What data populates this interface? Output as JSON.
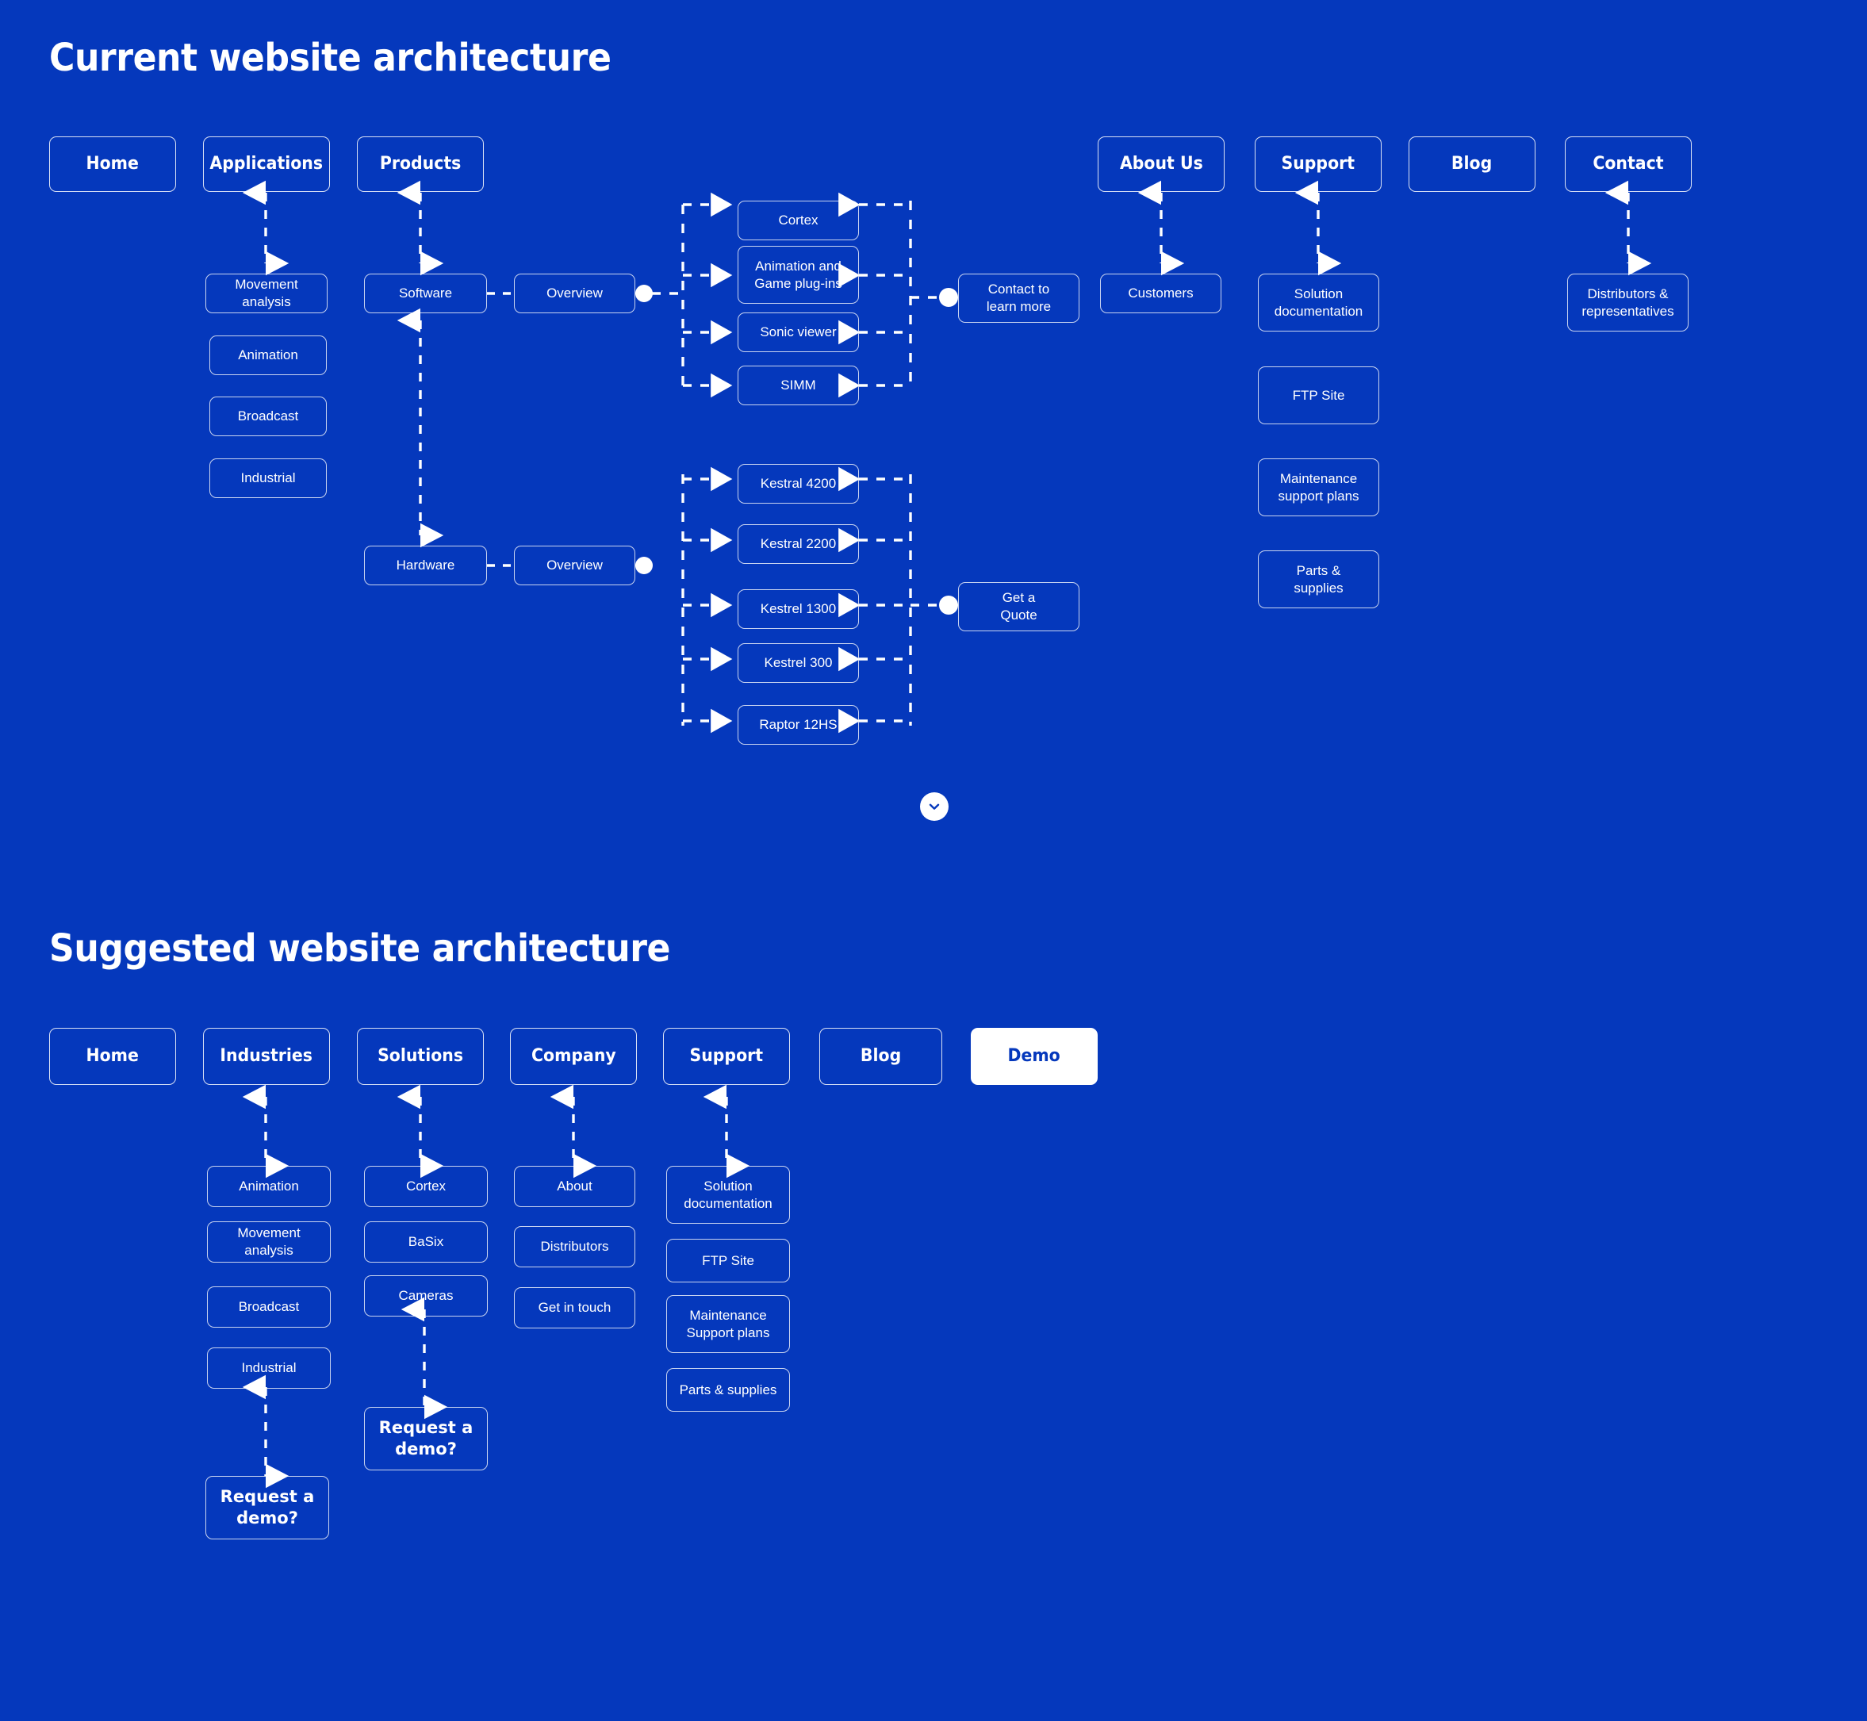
{
  "theme": {
    "background": "#0538bc",
    "line": "#ffffff",
    "text": "#ffffff",
    "cta_background": "#ffffff",
    "cta_text": "#0538bc"
  },
  "sections": [
    {
      "id": "current",
      "title": "Current website architecture",
      "nav": [
        {
          "label": "Home"
        },
        {
          "label": "Applications"
        },
        {
          "label": "Products"
        },
        {
          "label": "About Us"
        },
        {
          "label": "Support"
        },
        {
          "label": "Blog"
        },
        {
          "label": "Contact"
        }
      ],
      "applications_children": [
        {
          "label": "Movement analysis"
        },
        {
          "label": "Animation"
        },
        {
          "label": "Broadcast"
        },
        {
          "label": "Industrial"
        }
      ],
      "products_branches": [
        {
          "label": "Software",
          "overview_label": "Overview",
          "items": [
            {
              "label": "Cortex"
            },
            {
              "label": "Animation and\nGame plug-ins"
            },
            {
              "label": "Sonic viewer"
            },
            {
              "label": "SIMM"
            }
          ],
          "endpoint": "Contact to\nlearn more"
        },
        {
          "label": "Hardware",
          "overview_label": "Overview",
          "items": [
            {
              "label": "Kestral 4200"
            },
            {
              "label": "Kestral 2200"
            },
            {
              "label": "Kestrel 1300"
            },
            {
              "label": "Kestrel 300"
            },
            {
              "label": "Raptor 12HS"
            }
          ],
          "endpoint": "Get a\nQuote"
        }
      ],
      "about_children": [
        {
          "label": "Customers"
        }
      ],
      "support_children": [
        {
          "label": "Solution\ndocumentation"
        },
        {
          "label": "FTP Site"
        },
        {
          "label": "Maintenance\nsupport plans"
        },
        {
          "label": "Parts &\nsupplies"
        }
      ],
      "contact_children": [
        {
          "label": "Distributors &\nrepresentatives"
        }
      ]
    },
    {
      "id": "suggested",
      "title": "Suggested website architecture",
      "nav": [
        {
          "label": "Home",
          "cta": false
        },
        {
          "label": "Industries",
          "cta": false
        },
        {
          "label": "Solutions",
          "cta": false
        },
        {
          "label": "Company",
          "cta": false
        },
        {
          "label": "Support",
          "cta": false
        },
        {
          "label": "Blog",
          "cta": false
        },
        {
          "label": "Demo",
          "cta": true
        }
      ],
      "industries_children": [
        {
          "label": "Animation"
        },
        {
          "label": "Movement analysis"
        },
        {
          "label": "Broadcast"
        },
        {
          "label": "Industrial"
        }
      ],
      "industries_cta": "Request a\ndemo?",
      "solutions_children": [
        {
          "label": "Cortex"
        },
        {
          "label": "BaSix"
        },
        {
          "label": "Cameras"
        }
      ],
      "solutions_cta": "Request a\ndemo?",
      "company_children": [
        {
          "label": "About"
        },
        {
          "label": "Distributors"
        },
        {
          "label": "Get in touch"
        }
      ],
      "support_children": [
        {
          "label": "Solution\ndocumentation"
        },
        {
          "label": "FTP Site"
        },
        {
          "label": "Maintenance\nSupport plans"
        },
        {
          "label": "Parts & supplies"
        }
      ]
    }
  ],
  "scroll_button": {
    "icon": "chevron-down-icon"
  }
}
